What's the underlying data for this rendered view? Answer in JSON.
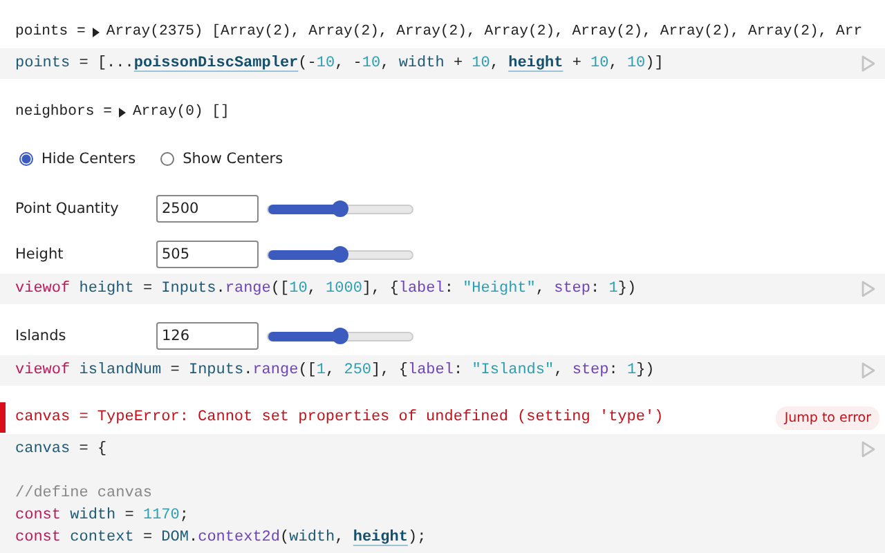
{
  "cells": [
    {
      "kind": "output",
      "label": "points =",
      "value": "Array(2375) [Array(2), Array(2), Array(2), Array(2), Array(2), Array(2), Array(2), Arr"
    },
    {
      "kind": "code",
      "blocks": [
        [
          "points = [...**poissonDiscSampler**(-10, -10, width + 10, **height** + 10, 10)]"
        ]
      ]
    },
    {
      "kind": "output",
      "label": "neighbors =",
      "value": "Array(0) []"
    },
    {
      "kind": "radio",
      "options": [
        {
          "label": "Hide Centers",
          "selected": true
        },
        {
          "label": "Show Centers",
          "selected": false
        }
      ]
    },
    {
      "kind": "range",
      "label": "Point Quantity",
      "value": "2500",
      "level": 0.5
    },
    {
      "kind": "range",
      "label": "Height",
      "value": "505",
      "level": 0.5
    },
    {
      "kind": "code",
      "blocks": [
        [
          "viewof height = Inputs.range([10, 1000], {label: \"Height\", step: 1})"
        ]
      ]
    },
    {
      "kind": "range",
      "label": "Islands",
      "value": "126",
      "level": 0.5
    },
    {
      "kind": "code",
      "blocks": [
        [
          "viewof islandNum = Inputs.range([1, 250], {label: \"Islands\", step: 1})"
        ]
      ]
    },
    {
      "kind": "error",
      "text": "canvas = TypeError: Cannot set properties of undefined (setting 'type')",
      "button": "Jump to error"
    },
    {
      "kind": "code",
      "blocks": [
        [
          "canvas = {"
        ],
        [
          "//define canvas",
          "const width = 1170;",
          "const context = DOM.context2d(width, **height**);"
        ]
      ]
    }
  ]
}
